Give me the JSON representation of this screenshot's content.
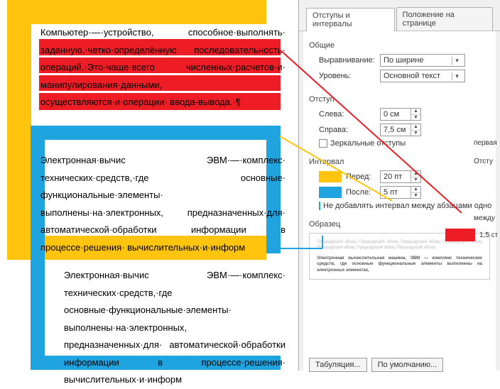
{
  "doc": {
    "p1": "Компьютер·—·устройство, способное·выполнять· заданную,·четко·определённую последовательность· операций.·Это·чаще·всего численных·расчетов·и· манипулирования·данными, осуществляются·и·операции· ввода-вывода.·¶",
    "p2": "Электронная·вычис ЭВМ·—·комплекс· технических·средств,·где основные· функциональные·элементы· выполнены·на·электронных, предназначенных·для· автоматической·обработки информации в процессе·решения· вычислительных·и·информ",
    "p3": "Электронная·вычис ЭВМ·—·комплекс· технических·средств,·где основные·функциональные·элементы· выполнены·на·электронных, предназначенных·для· автоматической·обработки информации в процессе·решения· вычислительных·и·информ"
  },
  "panel": {
    "tab1": "Отступы и интервалы",
    "tab2": "Положение на странице",
    "general": "Общие",
    "align": "Выравнивание:",
    "align_v": "По ширине",
    "level": "Уровень:",
    "level_v": "Основной текст",
    "indent": "Отступ",
    "left": "Слева:",
    "left_v": "0 см",
    "first": "первая",
    "right": "Справа:",
    "right_v": "7,5 см",
    "indent_r": "Отсту",
    "mirror": "Зеркальные отступы",
    "interval": "Интервал",
    "before": "Перед:",
    "before_v": "20 пт",
    "between": "между",
    "after": "После:",
    "after_v": "5 пт",
    "linesp": "1,5 ст",
    "nogap": "Не добавлять интервал между абзацами одно",
    "sample": "Образец",
    "sample_txt1": "Предыдущий абзац Предыдущий абзац Предыдущий абзац Предыдущий абзац Предыдущий абзац Предыдущий абзац Предыдущий абзац",
    "sample_txt2": "Электронная вычислительная машина, ЭВМ — комплекс технических средств, где основные функциональные элементы выполнены на электронных элементах,",
    "tabbtn": "Табуляция...",
    "defbtn": "По умолчанию..."
  }
}
